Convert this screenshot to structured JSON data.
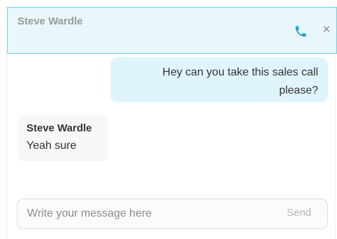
{
  "header": {
    "contact_name": "Steve Wardle",
    "call_icon": "phone-icon",
    "close_icon": "close-icon",
    "close_glyph": "×",
    "accent_color": "#1aa6d6",
    "background_color": "#e9f7fd",
    "border_color": "#6fcdea"
  },
  "messages": [
    {
      "direction": "outgoing",
      "text": "Hey can you take this sales call please?"
    },
    {
      "direction": "incoming",
      "sender": "Steve Wardle",
      "text": "Yeah sure"
    }
  ],
  "composer": {
    "placeholder": "Write your message here",
    "value": "",
    "send_label": "Send"
  }
}
